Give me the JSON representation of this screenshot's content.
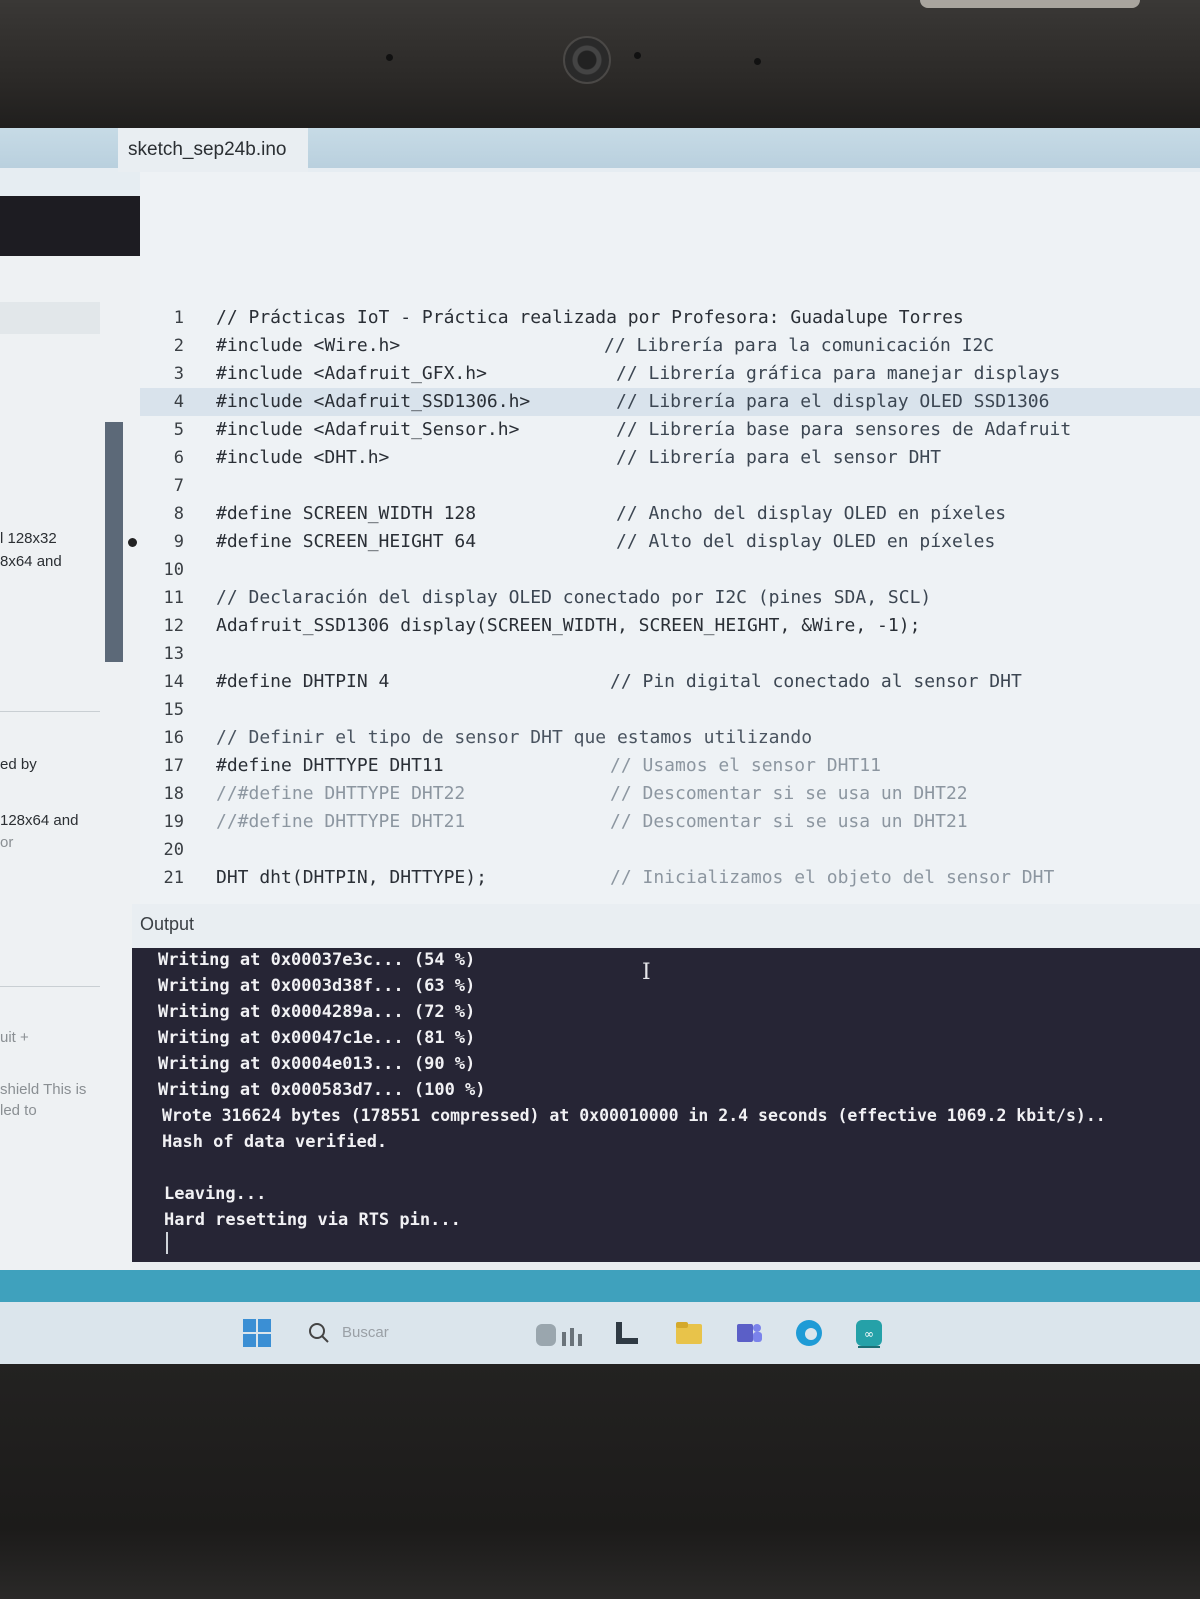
{
  "editor": {
    "tab_title": "sketch_sep24b.ino",
    "lines": [
      {
        "n": "1",
        "code": "// Prácticas IoT - Práctica realizada por Profesora: Guadalupe Torres",
        "comment": ""
      },
      {
        "n": "2",
        "code": "#include <Wire.h>",
        "comment": "// Librería para la comunicación I2C"
      },
      {
        "n": "3",
        "code": "#include <Adafruit_GFX.h>",
        "comment": "// Librería gráfica para manejar displays"
      },
      {
        "n": "4",
        "code": "#include <Adafruit_SSD1306.h>",
        "comment": "// Librería para el display OLED SSD1306"
      },
      {
        "n": "5",
        "code": "#include <Adafruit_Sensor.h>",
        "comment": "// Librería base para sensores de Adafruit"
      },
      {
        "n": "6",
        "code": "#include <DHT.h>",
        "comment": "// Librería para el sensor DHT"
      },
      {
        "n": "7",
        "code": "",
        "comment": ""
      },
      {
        "n": "8",
        "code": "#define SCREEN_WIDTH 128",
        "comment": "// Ancho del display OLED en píxeles"
      },
      {
        "n": "9",
        "code": "#define SCREEN_HEIGHT 64",
        "comment": "// Alto del display OLED en píxeles"
      },
      {
        "n": "10",
        "code": "",
        "comment": ""
      },
      {
        "n": "11",
        "code": "// Declaración del display OLED conectado por I2C (pines SDA, SCL)",
        "comment": ""
      },
      {
        "n": "12",
        "code": "Adafruit_SSD1306 display(SCREEN_WIDTH, SCREEN_HEIGHT, &Wire, -1);",
        "comment": ""
      },
      {
        "n": "13",
        "code": "",
        "comment": ""
      },
      {
        "n": "14",
        "code": "#define DHTPIN 4",
        "comment": "// Pin digital conectado al sensor DHT"
      },
      {
        "n": "15",
        "code": "",
        "comment": ""
      },
      {
        "n": "16",
        "code": "// Definir el tipo de sensor DHT que estamos utilizando",
        "comment": ""
      },
      {
        "n": "17",
        "code": "#define DHTTYPE DHT11",
        "comment": "// Usamos el sensor DHT11"
      },
      {
        "n": "18",
        "code": "//#define DHTTYPE DHT22",
        "comment": "// Descomentar si se usa un DHT22"
      },
      {
        "n": "19",
        "code": "//#define DHTTYPE DHT21",
        "comment": "// Descomentar si se usa un DHT21"
      },
      {
        "n": "20",
        "code": "",
        "comment": ""
      },
      {
        "n": "21",
        "code": "DHT dht(DHTPIN, DHTTYPE);",
        "comment": "// Inicializamos el objeto del sensor DHT"
      }
    ]
  },
  "left_panel": {
    "t1": "l 128x32",
    "t2": "8x64 and",
    "t3": "ed by",
    "t4": "128x64 and",
    "t5": "or",
    "t6": "uit +",
    "t7": "shield This is",
    "t8": "led to"
  },
  "output": {
    "header": "Output",
    "lines": [
      "Writing at 0x00037e3c... (54 %)",
      "Writing at 0x0003d38f... (63 %)",
      "Writing at 0x0004289a... (72 %)",
      "Writing at 0x00047c1e... (81 %)",
      "Writing at 0x0004e013... (90 %)",
      "Writing at 0x000583d7... (100 %)",
      "Wrote 316624 bytes (178551 compressed) at 0x00010000 in 2.4 seconds (effective 1069.2 kbit/s)..",
      "Hash of data verified.",
      "",
      "Leaving...",
      "Hard resetting via RTS pin..."
    ]
  },
  "taskbar": {
    "search_placeholder": "Buscar"
  }
}
